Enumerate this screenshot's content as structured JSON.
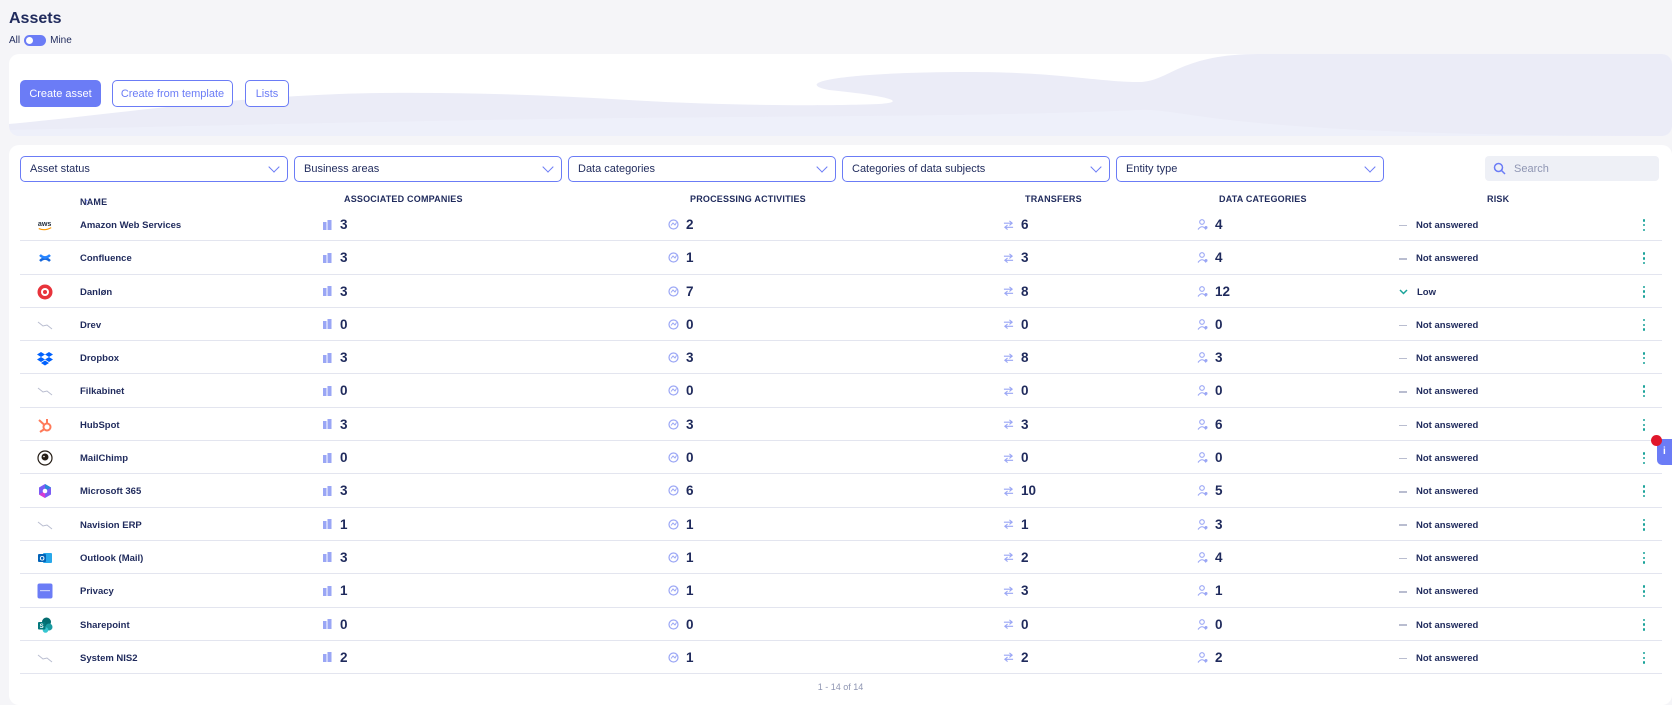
{
  "page": {
    "title": "Assets"
  },
  "scope_toggle": {
    "left_label": "All",
    "right_label": "Mine"
  },
  "actions": {
    "create_asset": "Create asset",
    "create_from_template": "Create from template",
    "lists": "Lists"
  },
  "filters": [
    "Asset status",
    "Business areas",
    "Data categories",
    "Categories of data subjects",
    "Entity type"
  ],
  "search": {
    "placeholder": "Search"
  },
  "columns": {
    "name": "NAME",
    "associated_companies": "ASSOCIATED COMPANIES",
    "processing_activities": "PROCESSING ACTIVITIES",
    "transfers": "TRANSFERS",
    "data_categories": "DATA CATEGORIES",
    "risk": "RISK"
  },
  "rows": [
    {
      "logo": "aws-logo",
      "name": "Amazon Web Services",
      "companies": "3",
      "activities": "2",
      "transfers": "6",
      "categories": "4",
      "risk": "Not answered",
      "risk_icon": "dash"
    },
    {
      "logo": "confluence-logo",
      "name": "Confluence",
      "companies": "3",
      "activities": "1",
      "transfers": "3",
      "categories": "4",
      "risk": "Not answered",
      "risk_icon": "dash"
    },
    {
      "logo": "danlon-logo",
      "name": "Danløn",
      "companies": "3",
      "activities": "7",
      "transfers": "8",
      "categories": "12",
      "risk": "Low",
      "risk_icon": "chevron-down"
    },
    {
      "logo": "placeholder-logo",
      "name": "Drev",
      "companies": "0",
      "activities": "0",
      "transfers": "0",
      "categories": "0",
      "risk": "Not answered",
      "risk_icon": "dash"
    },
    {
      "logo": "dropbox-logo",
      "name": "Dropbox",
      "companies": "3",
      "activities": "3",
      "transfers": "8",
      "categories": "3",
      "risk": "Not answered",
      "risk_icon": "dash"
    },
    {
      "logo": "placeholder-logo",
      "name": "Filkabinet",
      "companies": "0",
      "activities": "0",
      "transfers": "0",
      "categories": "0",
      "risk": "Not answered",
      "risk_icon": "dash"
    },
    {
      "logo": "hubspot-logo",
      "name": "HubSpot",
      "companies": "3",
      "activities": "3",
      "transfers": "3",
      "categories": "6",
      "risk": "Not answered",
      "risk_icon": "dash"
    },
    {
      "logo": "mailchimp-logo",
      "name": "MailChimp",
      "companies": "0",
      "activities": "0",
      "transfers": "0",
      "categories": "0",
      "risk": "Not answered",
      "risk_icon": "dash"
    },
    {
      "logo": "microsoft365-logo",
      "name": "Microsoft 365",
      "companies": "3",
      "activities": "6",
      "transfers": "10",
      "categories": "5",
      "risk": "Not answered",
      "risk_icon": "dash"
    },
    {
      "logo": "placeholder-logo",
      "name": "Navision ERP",
      "companies": "1",
      "activities": "1",
      "transfers": "1",
      "categories": "3",
      "risk": "Not answered",
      "risk_icon": "dash"
    },
    {
      "logo": "outlook-logo",
      "name": "Outlook (Mail)",
      "companies": "3",
      "activities": "1",
      "transfers": "2",
      "categories": "4",
      "risk": "Not answered",
      "risk_icon": "dash"
    },
    {
      "logo": "privacy-logo",
      "name": "Privacy",
      "companies": "1",
      "activities": "1",
      "transfers": "3",
      "categories": "1",
      "risk": "Not answered",
      "risk_icon": "dash"
    },
    {
      "logo": "sharepoint-logo",
      "name": "Sharepoint",
      "companies": "0",
      "activities": "0",
      "transfers": "0",
      "categories": "0",
      "risk": "Not answered",
      "risk_icon": "dash"
    },
    {
      "logo": "placeholder-logo",
      "name": "System NIS2",
      "companies": "2",
      "activities": "1",
      "transfers": "2",
      "categories": "2",
      "risk": "Not answered",
      "risk_icon": "dash"
    }
  ],
  "pagination": {
    "text": "1 - 14 of 14"
  },
  "colors": {
    "accent": "#6b7cf6",
    "text": "#1f2a5c",
    "kebab": "#1aa39a",
    "low_risk": "#1aa39a"
  }
}
